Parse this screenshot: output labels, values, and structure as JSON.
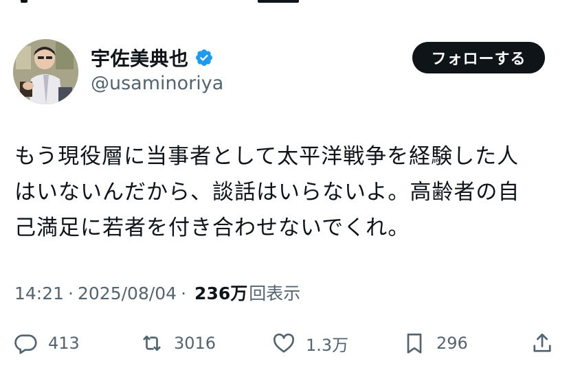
{
  "tweet": {
    "author": {
      "display_name": "宇佐美典也",
      "handle": "@usaminoriya",
      "verified": true,
      "verified_color": "#1d9bf0"
    },
    "follow_button_label": "フォローする",
    "text_lines": [
      "もう現役層に当事者として太平洋戦争を経験した人",
      "はいないんだから、談話はいらないよ。高齢者の自",
      "己満足に若者を付き合わせないでくれ。"
    ],
    "meta": {
      "time": "14:21",
      "separator": "·",
      "date": "2025/08/04",
      "views": "236万",
      "views_label": "回表示"
    },
    "actions": {
      "replies": "413",
      "reposts": "3016",
      "likes": "1.3万",
      "bookmarks": "296"
    }
  },
  "icons": {
    "reply": "speech-bubble-icon",
    "repost": "repost-arrows-icon",
    "like": "heart-icon",
    "bookmark": "bookmark-icon",
    "share": "share-upload-icon",
    "verified": "verified-badge-icon"
  },
  "colors": {
    "text_primary": "#0f1419",
    "text_secondary": "#536471",
    "follow_button_bg": "#0f1419"
  }
}
